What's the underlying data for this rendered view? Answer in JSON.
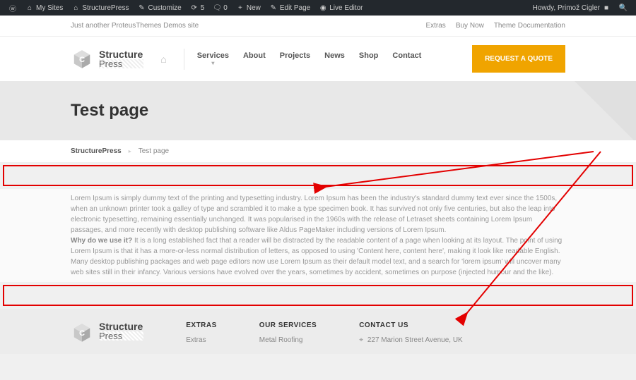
{
  "adminbar": {
    "my_sites": "My Sites",
    "site_name": "StructurePress",
    "customize": "Customize",
    "updates_count": "5",
    "comments_count": "0",
    "new": "New",
    "edit_page": "Edit Page",
    "live_editor": "Live Editor",
    "howdy": "Howdy, Primož Cigler"
  },
  "topbar": {
    "tagline": "Just another ProteusThemes Demos site",
    "links": [
      "Extras",
      "Buy Now",
      "Theme Documentation"
    ]
  },
  "brand": {
    "line1": "Structure",
    "line2": "Press"
  },
  "nav": {
    "items": [
      "Services",
      "About",
      "Projects",
      "News",
      "Shop",
      "Contact"
    ],
    "cta": "REQUEST A QUOTE"
  },
  "page": {
    "title": "Test page"
  },
  "breadcrumb": {
    "home": "StructurePress",
    "current": "Test page"
  },
  "content": {
    "p1": "Lorem Ipsum is simply dummy text of the printing and typesetting industry. Lorem Ipsum has been the industry's standard dummy text ever since the 1500s, when an unknown printer took a galley of type and scrambled it to make a type specimen book. It has survived not only five centuries, but also the leap into electronic typesetting, remaining essentially unchanged. It was popularised in the 1960s with the release of Letraset sheets containing Lorem Ipsum passages, and more recently with desktop publishing software like Aldus PageMaker including versions of Lorem Ipsum.",
    "bold": "Why do we use it?",
    "p2": " It is a long established fact that a reader will be distracted by the readable content of a page when looking at its layout. The point of using Lorem Ipsum is that it has a more-or-less normal distribution of letters, as opposed to using 'Content here, content here', making it look like readable English. Many desktop publishing packages and web page editors now use Lorem Ipsum as their default model text, and a search for 'lorem ipsum' will uncover many web sites still in their infancy. Various versions have evolved over the years, sometimes by accident, sometimes on purpose (injected humour and the like)."
  },
  "footer": {
    "extras": {
      "heading": "EXTRAS",
      "items": [
        "Extras"
      ]
    },
    "services": {
      "heading": "OUR SERVICES",
      "items": [
        "Metal Roofing"
      ]
    },
    "contact": {
      "heading": "CONTACT US",
      "address": "227 Marion Street Avenue, UK"
    }
  }
}
